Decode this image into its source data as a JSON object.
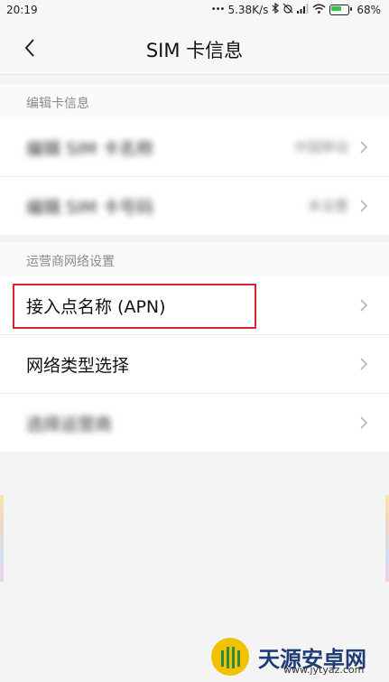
{
  "status_bar": {
    "time": "20:19",
    "dots": "•••",
    "net_speed": "5.38K/s",
    "battery": "68%"
  },
  "header": {
    "title": "SIM 卡信息"
  },
  "sections": [
    {
      "title": "编辑卡信息",
      "rows": [
        {
          "label": "编辑 SIM 卡名称",
          "value": "中国移动",
          "blurred": true
        },
        {
          "label": "编辑 SIM 卡号码",
          "value": "未设置",
          "blurred": true
        }
      ]
    },
    {
      "title": "运营商网络设置",
      "rows": [
        {
          "label": "接入点名称 (APN)",
          "highlighted": true
        },
        {
          "label": "网络类型选择"
        },
        {
          "label": "选择运营商",
          "blurred": true
        }
      ]
    }
  ],
  "watermark": {
    "name": "天源安卓网",
    "url": "www.jytyaz.com"
  },
  "colors": {
    "highlight": "#d9262c",
    "battery": "#37c24a",
    "watermark": "#1f3c78"
  }
}
